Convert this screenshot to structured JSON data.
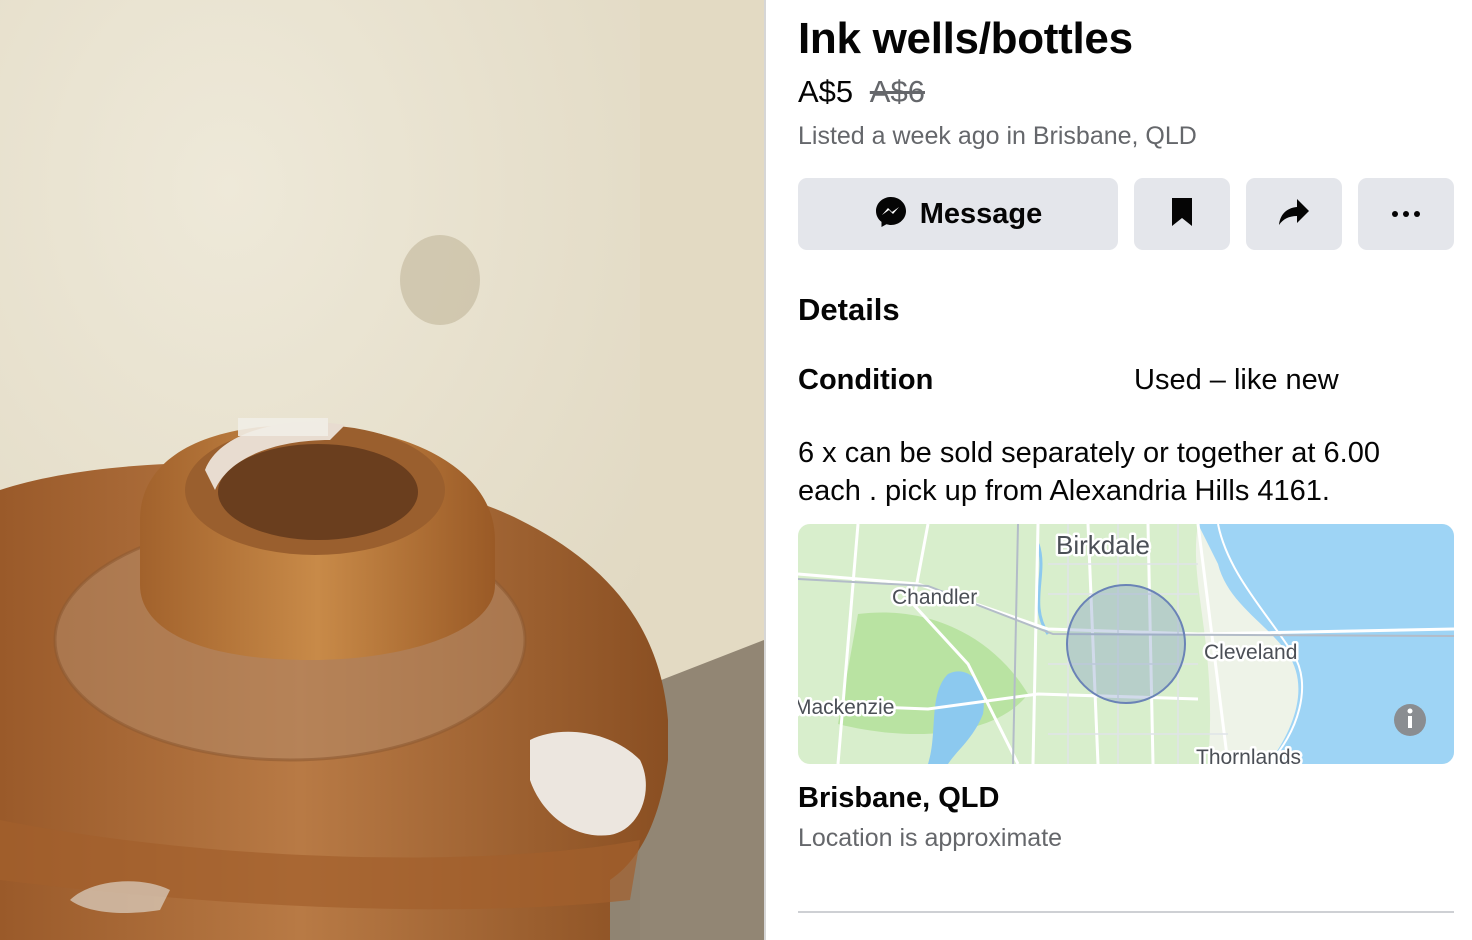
{
  "listing": {
    "title": "Ink wells/bottles",
    "price": "A$5",
    "original_price": "A$6",
    "listed": "Listed a week ago in Brisbane, QLD"
  },
  "actions": {
    "message_label": "Message",
    "save_icon": "bookmark-icon",
    "share_icon": "share-arrow-icon",
    "more_icon": "more-dots-icon"
  },
  "details": {
    "heading": "Details",
    "condition_label": "Condition",
    "condition_value": "Used – like new",
    "description_line1": "6  x can be sold separately or together at 6.00",
    "description_line2": "each  . pick up from Alexandria Hills 4161."
  },
  "map": {
    "labels": {
      "birkdale": "Birkdale",
      "chandler": "Chandler",
      "cleveland": "Cleveland",
      "mackenzie": "Mackenzie",
      "thornlands": "Thornlands"
    },
    "info_icon": "info-icon"
  },
  "location": {
    "name": "Brisbane, QLD",
    "note": "Location is approximate"
  },
  "colors": {
    "button_bg": "#e4e6eb",
    "secondary_text": "#65676b",
    "map_water": "#9ed4f5",
    "map_land": "#c6e9b4"
  }
}
